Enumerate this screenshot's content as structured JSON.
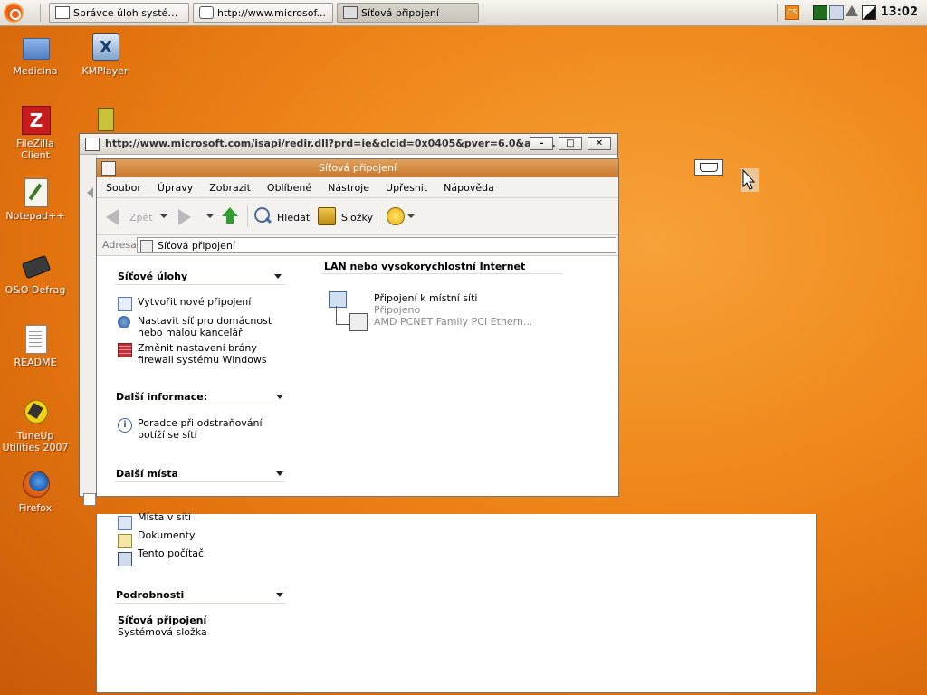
{
  "taskbar": {
    "tasks": [
      {
        "label": "Správce úloh systém..."
      },
      {
        "label": "http://www.microsof..."
      },
      {
        "label": "Síťová připojení"
      }
    ],
    "clock": "13:02"
  },
  "desktop": {
    "icons": [
      {
        "label": "Medicina",
        "icon": "folder-icon"
      },
      {
        "label": "KMPlayer",
        "icon": "kmplayer-icon"
      },
      {
        "label": "FileZilla Client",
        "icon": "filezilla-icon"
      },
      {
        "label": "Notepad++",
        "icon": "notepad-icon"
      },
      {
        "label": "O&O Defrag",
        "icon": "defrag-icon"
      },
      {
        "label": "README",
        "icon": "document-icon"
      },
      {
        "label": "TuneUp Utilities 2007",
        "icon": "tuneup-icon"
      },
      {
        "label": "Firefox",
        "icon": "firefox-icon"
      }
    ]
  },
  "ie_window": {
    "title": "http://www.microsoft.com/isapi/redir.dll?prd=ie&clcid=0x0405&pver=6.0&ar=..."
  },
  "explorer": {
    "title": "Síťová připojení",
    "menu": [
      "Soubor",
      "Úpravy",
      "Zobrazit",
      "Oblíbené",
      "Nástroje",
      "Upřesnit",
      "Nápověda"
    ],
    "toolbar": {
      "back": "Zpět",
      "search": "Hledat",
      "folders": "Složky"
    },
    "address_label": "Adresa",
    "address_value": "Síťová připojení",
    "sections": {
      "network_tasks": {
        "title": "Síťové úlohy",
        "items": [
          "Vytvořit nové připojení",
          "Nastavit síť pro domácnost nebo malou kancelář",
          "Změnit nastavení brány firewall systému Windows"
        ]
      },
      "more_info": {
        "title": "Další informace:",
        "items": [
          "Poradce při odstraňování potíží se sítí"
        ]
      },
      "other_places": {
        "title": "Další místa",
        "items": [
          "Místa v síti",
          "Dokumenty",
          "Tento počítač"
        ]
      },
      "details": {
        "title": "Podrobnosti",
        "name": "Síťová připojení",
        "type": "Systémová složka"
      }
    },
    "content": {
      "group_title": "LAN nebo vysokorychlostní Internet",
      "connection": {
        "name": "Připojení k místní síti",
        "status": "Připojeno",
        "adapter": "AMD PCNET Family PCI Ethern..."
      }
    }
  },
  "colors": {
    "title_orange": "#c9772d",
    "desktop_orange": "#f08a1c"
  }
}
